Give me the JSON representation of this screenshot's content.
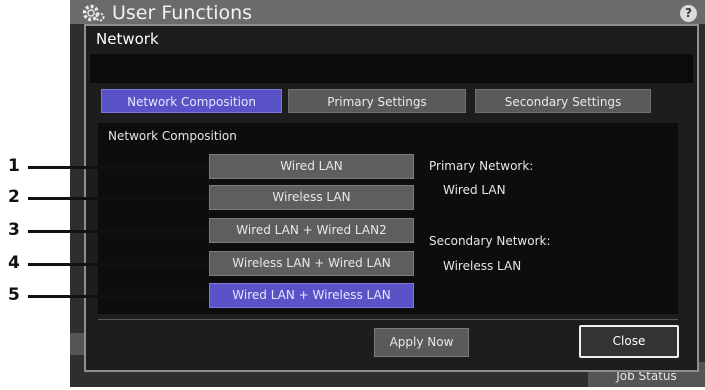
{
  "app": {
    "title": "User Functions",
    "help_label": "?",
    "job_status_label": "Job Status"
  },
  "dialog": {
    "title": "Network",
    "tabs": [
      {
        "label": "Network Composition",
        "active": true
      },
      {
        "label": "Primary Settings",
        "active": false
      },
      {
        "label": "Secondary Settings",
        "active": false
      }
    ],
    "panel_heading": "Network Composition",
    "options": [
      {
        "label": "Wired LAN",
        "selected": false
      },
      {
        "label": "Wireless LAN",
        "selected": false
      },
      {
        "label": "Wired LAN + Wired LAN2",
        "selected": false
      },
      {
        "label": "Wireless LAN + Wired LAN",
        "selected": false
      },
      {
        "label": "Wired LAN + Wireless LAN",
        "selected": true
      }
    ],
    "primary_network": {
      "label": "Primary Network:",
      "value": "Wired LAN"
    },
    "secondary_network": {
      "label": "Secondary Network:",
      "value": "Wireless LAN"
    },
    "apply_now_label": "Apply Now",
    "close_label": "Close"
  },
  "callouts": [
    "1",
    "2",
    "3",
    "4",
    "5"
  ],
  "colors": {
    "accent": "#5a52c7",
    "button": "#5e5e5e",
    "dialog_bg": "#1d1d1d",
    "panel_bg": "#0d0d0d"
  }
}
